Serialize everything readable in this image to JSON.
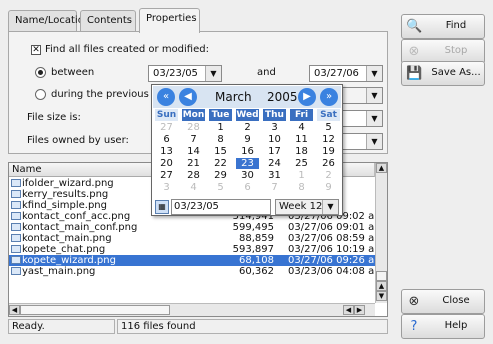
{
  "tabs": [
    "Name/Location",
    "Contents",
    "Properties"
  ],
  "find_all_label": "Find all files created or modified:",
  "between_label": "between",
  "during_label": "during the previous",
  "date_from": "03/23/05",
  "and_label": "and",
  "date_to": "03/27/06",
  "file_size_label": "File size is:",
  "owned_by_label": "Files owned by user:",
  "buttons": {
    "find": "Find",
    "stop": "Stop",
    "save_as": "Save As...",
    "close": "Close",
    "help": "Help"
  },
  "calendar": {
    "month": "March",
    "year": "2005",
    "weekdays": [
      "Sun",
      "Mon",
      "Tue",
      "Wed",
      "Thu",
      "Fri",
      "Sat"
    ],
    "weeks": [
      [
        "27",
        "28",
        "1",
        "2",
        "3",
        "4",
        "5"
      ],
      [
        "6",
        "7",
        "8",
        "9",
        "10",
        "11",
        "12"
      ],
      [
        "13",
        "14",
        "15",
        "16",
        "17",
        "18",
        "19"
      ],
      [
        "20",
        "21",
        "22",
        "23",
        "24",
        "25",
        "26"
      ],
      [
        "27",
        "28",
        "29",
        "30",
        "31",
        "1",
        "2"
      ],
      [
        "3",
        "4",
        "5",
        "6",
        "7",
        "8",
        "9"
      ]
    ],
    "selected": "23",
    "date_input": "03/23/05",
    "week": "Week 12"
  },
  "list": {
    "header_name": "Name",
    "header_col2": "I",
    "rows": [
      {
        "name": "ifolder_wizard.png",
        "size": "",
        "date": "11:15 a"
      },
      {
        "name": "kerry_results.png",
        "size": "",
        "date": "04:48 p"
      },
      {
        "name": "kfind_simple.png",
        "size": "",
        "date": "04:54 p"
      },
      {
        "name": "kontact_conf_acc.png",
        "size": "514,941",
        "date": "03/27/06 09:02 a"
      },
      {
        "name": "kontact_main_conf.png",
        "size": "599,495",
        "date": "03/27/06 09:01 a"
      },
      {
        "name": "kontact_main.png",
        "size": "88,859",
        "date": "03/27/06 08:59 a"
      },
      {
        "name": "kopete_chat.png",
        "size": "593,897",
        "date": "03/27/06 10:19 a"
      },
      {
        "name": "kopete_wizard.png",
        "size": "68,108",
        "date": "03/27/06 09:26 a"
      },
      {
        "name": "yast_main.png",
        "size": "60,362",
        "date": "03/23/06 04:08 a"
      }
    ],
    "selected_index": 7
  },
  "status": {
    "left": "Ready.",
    "right": "116 files found"
  }
}
